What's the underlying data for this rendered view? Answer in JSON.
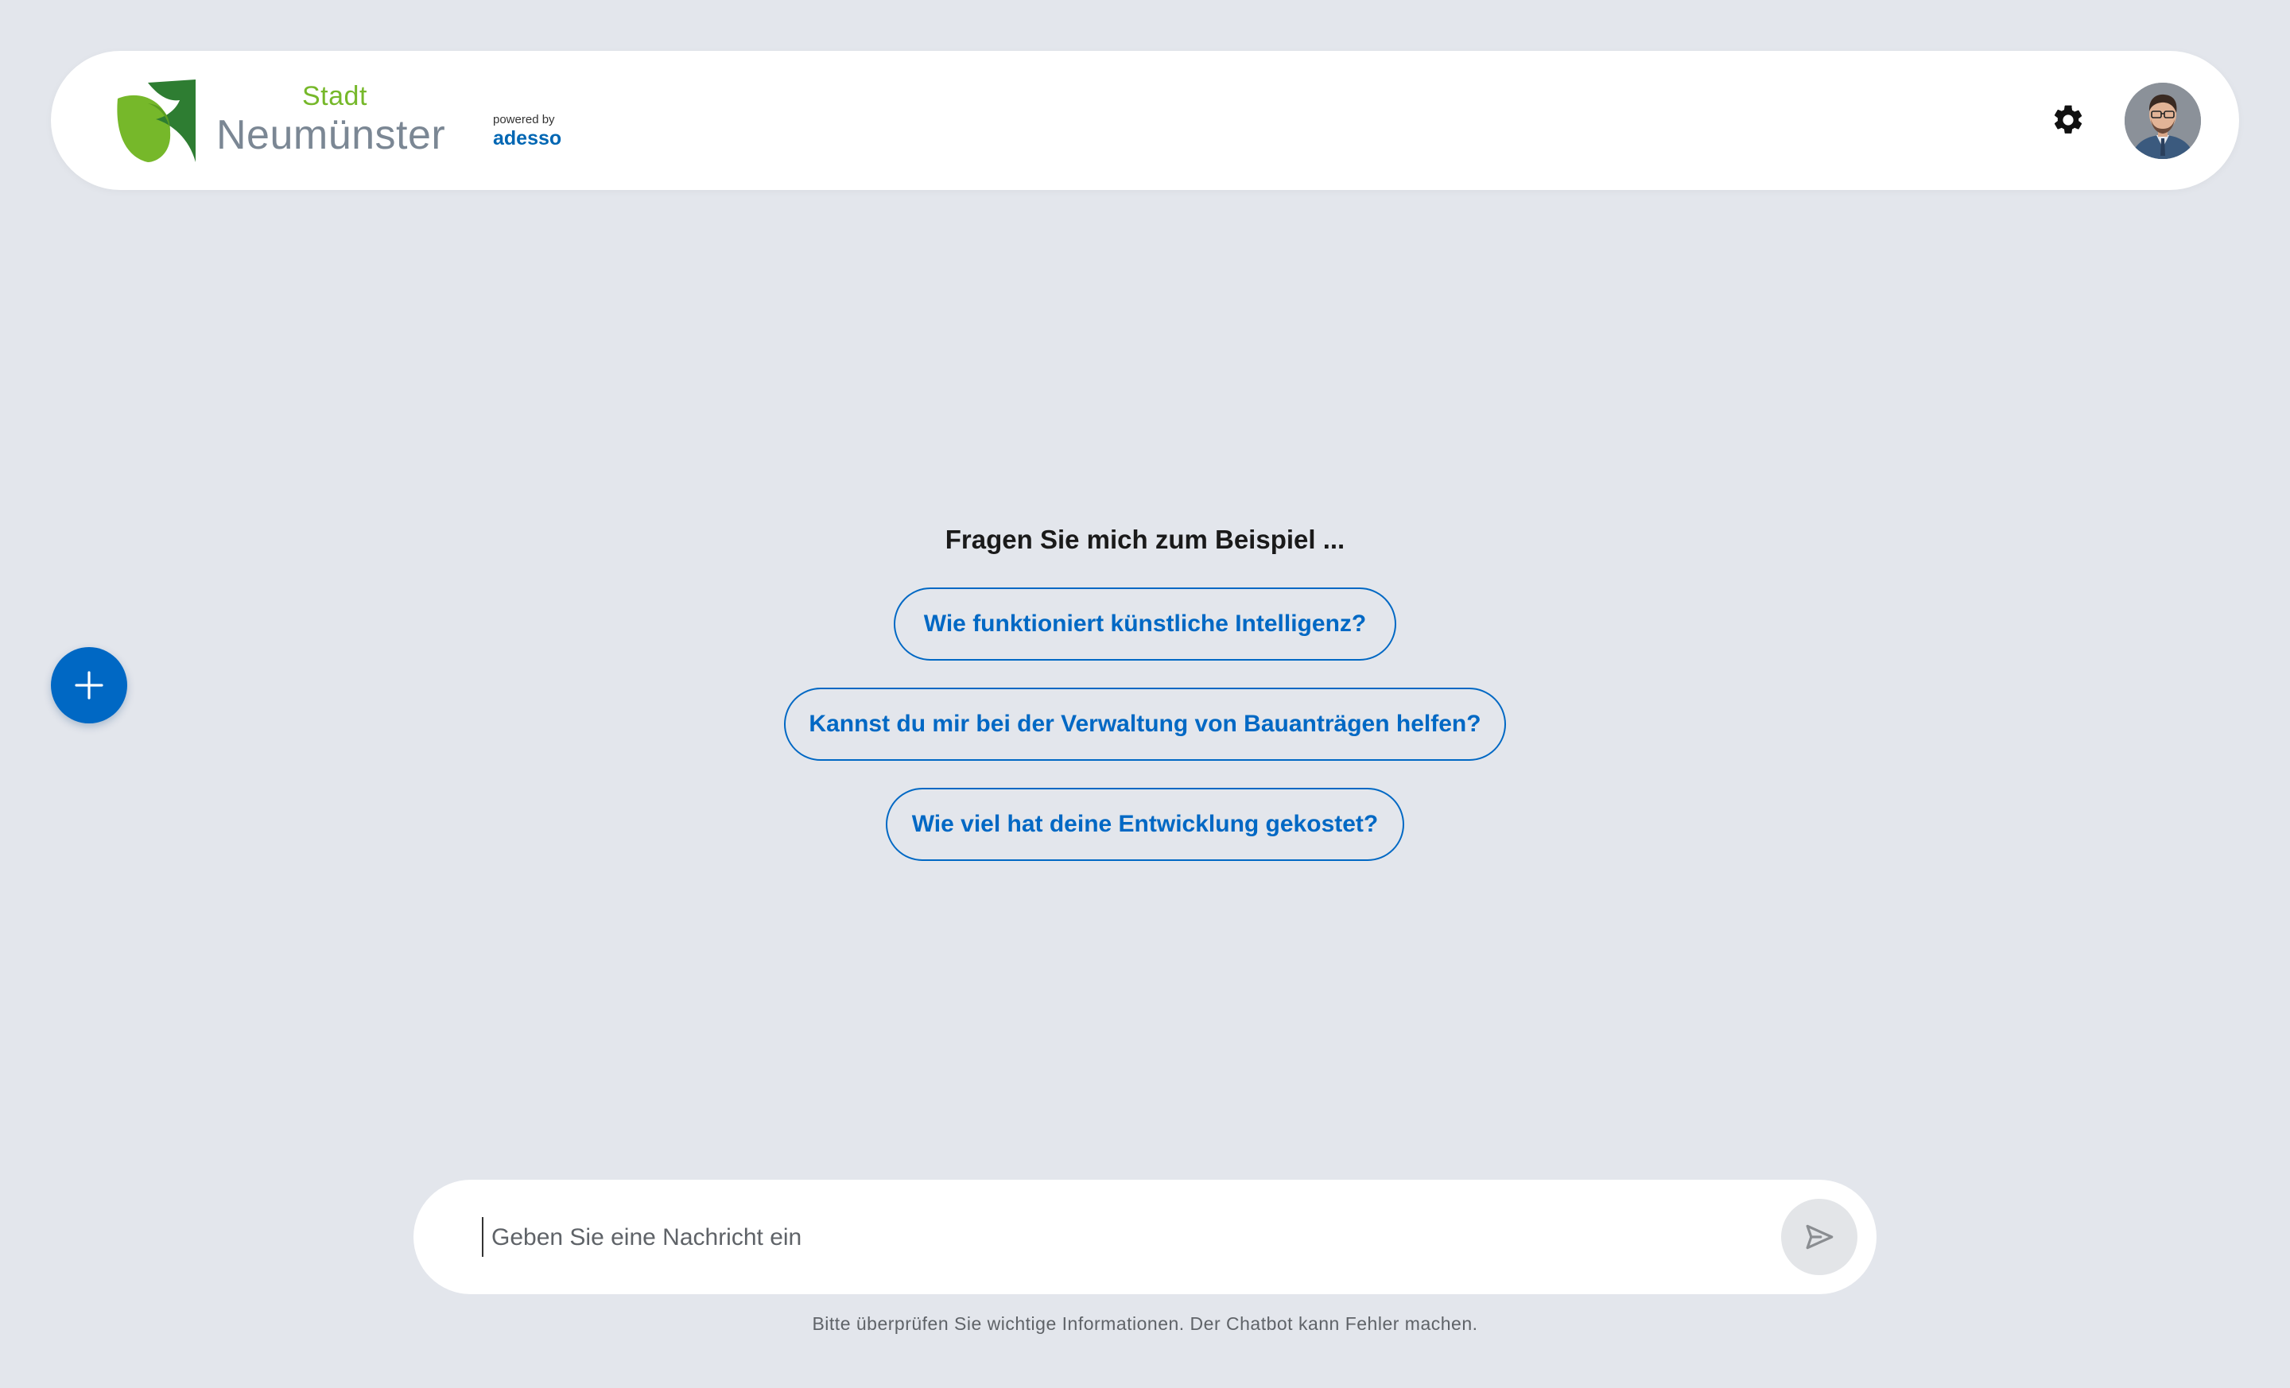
{
  "header": {
    "logo": {
      "small_text": "Stadt",
      "name": "Neumünster",
      "mark_icon": "leaf-logo-icon",
      "colors": {
        "green_light": "#76b82a",
        "green_dark": "#2e7d32",
        "grey": "#7b8794"
      }
    },
    "powered": {
      "label": "powered by",
      "brand": "adesso"
    },
    "settings_icon": "gear-icon",
    "avatar": "user-avatar"
  },
  "sidebar": {
    "new_chat_icon": "plus-icon"
  },
  "suggestions": {
    "title": "Fragen Sie mich zum Beispiel ...",
    "items": [
      {
        "label": "Wie funktioniert künstliche Intelligenz?"
      },
      {
        "label": "Kannst du mir bei der Verwaltung von Bauanträgen helfen?"
      },
      {
        "label": "Wie viel hat deine Entwicklung gekostet?"
      }
    ]
  },
  "composer": {
    "placeholder": "Geben Sie eine Nachricht ein",
    "send_icon": "send-icon",
    "disclaimer": "Bitte überprüfen Sie wichtige Informationen. Der Chatbot kann Fehler machen."
  },
  "colors": {
    "background": "#e3e6ec",
    "accent": "#0068c4",
    "surface": "#ffffff"
  }
}
